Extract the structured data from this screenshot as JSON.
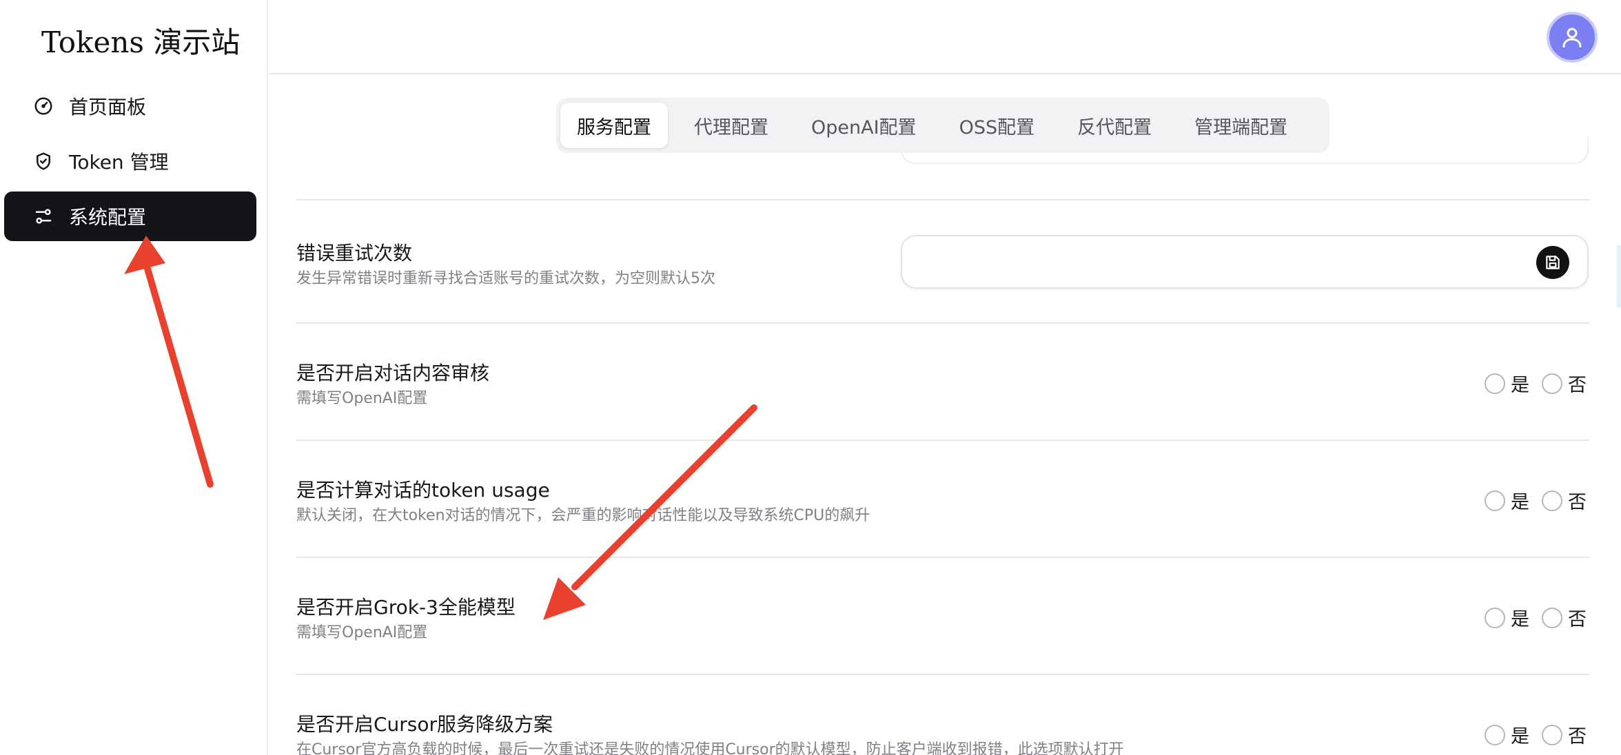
{
  "brand": "Tokens 演示站",
  "sidebar": {
    "items": [
      {
        "label": "首页面板",
        "icon": "gauge-icon",
        "active": false
      },
      {
        "label": "Token 管理",
        "icon": "shield-check-icon",
        "active": false
      },
      {
        "label": "系统配置",
        "icon": "sliders-icon",
        "active": true
      }
    ]
  },
  "tabs": [
    {
      "label": "服务配置",
      "active": true
    },
    {
      "label": "代理配置",
      "active": false
    },
    {
      "label": "OpenAI配置",
      "active": false
    },
    {
      "label": "OSS配置",
      "active": false
    },
    {
      "label": "反代配置",
      "active": false
    },
    {
      "label": "管理端配置",
      "active": false
    }
  ],
  "settings": {
    "retry": {
      "title": "错误重试次数",
      "desc": "发生异常错误时重新寻找合适账号的重试次数，为空则默认5次",
      "value": ""
    },
    "moderation": {
      "title": "是否开启对话内容审核",
      "desc": "需填写OpenAI配置"
    },
    "usage": {
      "title": "是否计算对话的token usage",
      "desc": "默认关闭，在大token对话的情况下，会严重的影响对话性能以及导致系统CPU的飙升"
    },
    "grok": {
      "title": "是否开启Grok-3全能模型",
      "desc": "需填写OpenAI配置"
    },
    "cursor": {
      "title": "是否开启Cursor服务降级方案",
      "desc": "在Cursor官方高负载的时候，最后一次重试还是失败的情况使用Cursor的默认模型，防止客户端收到报错，此选项默认打开"
    }
  },
  "radio": {
    "yes": "是",
    "no": "否"
  },
  "colors": {
    "accent": "#121418",
    "avatar": "#7b7ff2",
    "arrow": "#e8412e"
  }
}
